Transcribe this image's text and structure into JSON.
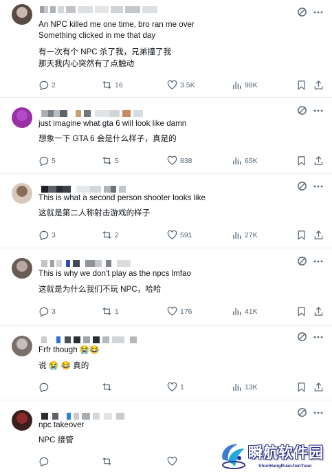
{
  "posts": [
    {
      "lines_en": [
        "An NPC killed me one time, bro ran me over",
        "Something clicked in me that day"
      ],
      "lines_cn": [
        "有一次有个 NPC 杀了我，兄弟撞了我",
        "那天我内心突然有了点触动"
      ],
      "stats": {
        "replies": "2",
        "reposts": "16",
        "likes": "3.5K",
        "views": "98K"
      },
      "avatar_colors": [
        "#5a4a45",
        "#c9b8b0"
      ]
    },
    {
      "lines_en": [
        "just imagine what gta 6 will look like damn"
      ],
      "lines_cn": [
        "想象一下 GTA 6 会是什么样子，真是的"
      ],
      "stats": {
        "replies": "5",
        "reposts": "5",
        "likes": "838",
        "views": "65K"
      },
      "avatar_colors": [
        "#9b2fa8",
        "#b54bc4"
      ]
    },
    {
      "lines_en": [
        "This is what a second person shooter looks like"
      ],
      "lines_cn": [
        "这就是第二人称射击游戏的样子"
      ],
      "stats": {
        "replies": "3",
        "reposts": "2",
        "likes": "591",
        "views": "27K"
      },
      "avatar_colors": [
        "#d8c8bc",
        "#8a6c5c"
      ]
    },
    {
      "lines_en": [
        "This is why we don't play as the npcs lmfao"
      ],
      "lines_cn": [
        "这就是为什么我们不玩 NPC，哈哈"
      ],
      "stats": {
        "replies": "3",
        "reposts": "1",
        "likes": "176",
        "views": "41K"
      },
      "avatar_colors": [
        "#6a5a55",
        "#b8a8a2"
      ]
    },
    {
      "lines_en": [
        "Frfr though 😭😂"
      ],
      "lines_cn": [
        "说 😭 😂 真的"
      ],
      "stats": {
        "replies": "",
        "reposts": "",
        "likes": "1",
        "views": "13K"
      },
      "avatar_colors": [
        "#7a6f6a",
        "#c8bdb8"
      ]
    },
    {
      "lines_en": [
        "npc takeover"
      ],
      "lines_cn": [
        "NPC 接管"
      ],
      "stats": {
        "replies": "",
        "reposts": "",
        "likes": "",
        "views": ""
      },
      "avatar_colors": [
        "#3a1e1e",
        "#8c2b2b"
      ]
    }
  ],
  "watermark": {
    "title": "瞬航软件园",
    "subtitle": "ShunHangRuanJianYuan"
  },
  "colors": {
    "text": "#0f1419",
    "muted": "#536471",
    "border": "#e6ecf0",
    "watermark_blue": "#2a2f8a"
  }
}
